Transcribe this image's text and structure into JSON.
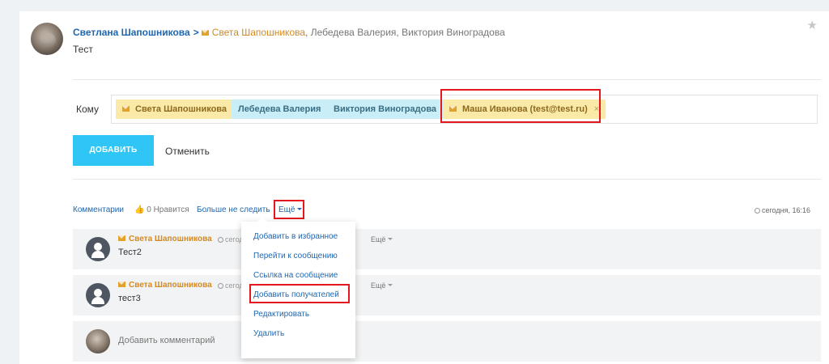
{
  "post": {
    "author": "Светлана Шапошникова",
    "arrow": ">",
    "recipients": [
      {
        "name": "Света Шапошникова",
        "sep": ", ",
        "style": "external"
      },
      {
        "name": "Лебедева Валерия",
        "sep": ", ",
        "style": "plain"
      },
      {
        "name": "Виктория Виноградова",
        "sep": "",
        "style": "plain"
      }
    ],
    "text": "Тест",
    "favorite_icon": "star-icon"
  },
  "to_form": {
    "label": "Кому",
    "chips": [
      {
        "label": "Света Шапошникова",
        "color": "yellow",
        "icon": "envelope-icon"
      },
      {
        "label": "Лебедева Валерия",
        "color": "blue"
      },
      {
        "label": "Виктория Виноградова",
        "color": "blue"
      },
      {
        "label": "Маша Иванова (test@test.ru)",
        "color": "yellow",
        "icon": "envelope-icon",
        "remove": "×",
        "highlighted": true
      }
    ],
    "add_button": "ДОБАВИТЬ",
    "cancel_button": "Отменить"
  },
  "actions": {
    "comments": "Комментарии",
    "like": "0 Нравится",
    "unfollow": "Больше не следить",
    "more": "Ещё",
    "time": "сегодня, 16:16"
  },
  "comments": [
    {
      "author": "Света Шапошникова",
      "date": "сегод",
      "more": "Ещё",
      "text": "Тест2"
    },
    {
      "author": "Света Шапошникова",
      "date": "сегод",
      "more": "Ещё",
      "text": "тест3"
    }
  ],
  "add_comment": {
    "placeholder": "Добавить комментарий"
  },
  "dropdown": {
    "items": [
      "Добавить в избранное",
      "Перейти к сообщению",
      "Ссылка на сообщение",
      "Добавить получателей",
      "Редактировать",
      "Удалить"
    ]
  },
  "colors": {
    "accent": "#2fc6f6",
    "link": "#2067b0",
    "external": "#d5891f",
    "highlight": "#e3171d"
  }
}
